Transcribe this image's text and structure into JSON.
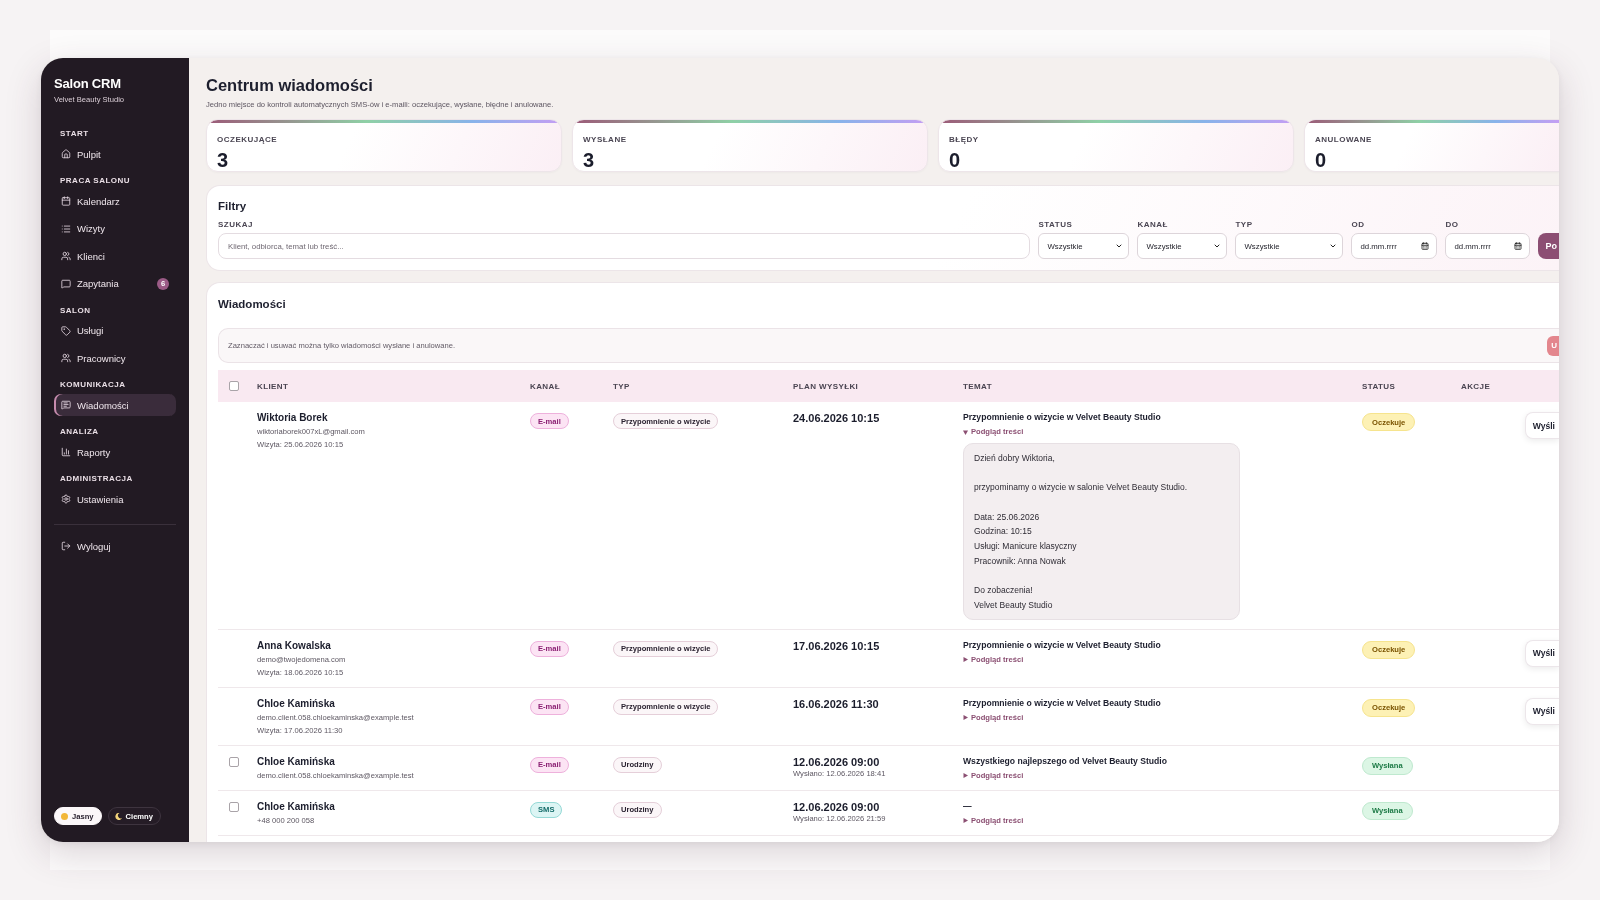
{
  "sidebar": {
    "brand": "Salon CRM",
    "subtitle": "Velvet Beauty Studio",
    "sections": [
      {
        "label": "START",
        "items": [
          {
            "label": "Pulpit",
            "selected": false
          }
        ]
      },
      {
        "label": "PRACA SALONU",
        "items": [
          {
            "label": "Kalendarz",
            "selected": false
          },
          {
            "label": "Wizyty",
            "selected": false
          },
          {
            "label": "Klienci",
            "selected": false
          },
          {
            "label": "Zapytania",
            "selected": false,
            "badge": "6"
          }
        ]
      },
      {
        "label": "SALON",
        "items": [
          {
            "label": "Usługi",
            "selected": false
          },
          {
            "label": "Pracownicy",
            "selected": false
          }
        ]
      },
      {
        "label": "KOMUNIKACJA",
        "items": [
          {
            "label": "Wiadomości",
            "selected": true
          }
        ]
      },
      {
        "label": "ANALIZA",
        "items": [
          {
            "label": "Raporty",
            "selected": false
          }
        ]
      },
      {
        "label": "ADMINISTRACJA",
        "items": [
          {
            "label": "Ustawienia",
            "selected": false
          }
        ]
      }
    ],
    "logout": "Wyloguj",
    "theme": [
      {
        "label": "Jasny",
        "selected": true
      },
      {
        "label": "Ciemny",
        "selected": false
      }
    ]
  },
  "page": {
    "title": "Centrum wiadomości",
    "subtitle": "Jedno miejsce do kontroli automatycznych SMS-ów i e-maili: oczekujące, wysłane, błędne i anulowane."
  },
  "stats": [
    {
      "label": "OCZEKUJĄCE",
      "value": "3"
    },
    {
      "label": "WYSŁANE",
      "value": "3"
    },
    {
      "label": "BŁĘDY",
      "value": "0"
    },
    {
      "label": "ANULOWANE",
      "value": "0"
    }
  ],
  "filters": {
    "title": "Filtry",
    "search": {
      "label": "SZUKAJ",
      "placeholder": "Klient, odbiorca, temat lub treść..."
    },
    "selects": [
      {
        "label": "STATUS",
        "value": "Wszystkie"
      },
      {
        "label": "KANAŁ",
        "value": "Wszystkie"
      },
      {
        "label": "TYP",
        "value": "Wszystkie"
      }
    ],
    "dates": [
      {
        "label": "OD",
        "placeholder": "dd.mm.rrrr"
      },
      {
        "label": "DO",
        "placeholder": "dd.mm.rrrr"
      }
    ],
    "submit": "Po"
  },
  "messages": {
    "title": "Wiadomości",
    "notice": "Zaznaczać i usuwać można tylko wiadomości wysłane i anulowane.",
    "bulk_action": "U",
    "table": {
      "select_all": {
        "checked": false
      },
      "columns": [
        "KLIENT",
        "KANAŁ",
        "TYP",
        "PLAN WYSYŁKI",
        "TEMAT",
        "STATUS",
        "AKCJE"
      ],
      "rows": [
        {
          "selectable": false,
          "client": {
            "name": "Wiktoria Borek",
            "contact": "wiktoriaborek007xL@gmail.com",
            "visit": "Wizyta: 25.06.2026 10:15"
          },
          "channel": {
            "label": "E-mail",
            "kind": "email"
          },
          "type": "Przypomnienie o wizycie",
          "plan": {
            "date": "24.06.2026 10:15"
          },
          "subject": "Przypomnienie o wizycie w Velvet Beauty Studio",
          "preview": {
            "label": "Podgląd treści",
            "expanded": true,
            "paragraphs": [
              "Dzień dobry Wiktoria,",
              "przypominamy o wizycie w salonie Velvet Beauty Studio.",
              "Data: 25.06.2026\nGodzina: 10:15\nUsługi: Manicure klasyczny\nPracownik: Anna Nowak",
              "Do zobaczenia!\nVelvet Beauty Studio"
            ]
          },
          "status": {
            "label": "Oczekuje",
            "kind": "pending"
          },
          "action": "Wyśli"
        },
        {
          "selectable": false,
          "client": {
            "name": "Anna Kowalska",
            "contact": "demo@twojedomena.com",
            "visit": "Wizyta: 18.06.2026 10:15"
          },
          "channel": {
            "label": "E-mail",
            "kind": "email"
          },
          "type": "Przypomnienie o wizycie",
          "plan": {
            "date": "17.06.2026 10:15"
          },
          "subject": "Przypomnienie o wizycie w Velvet Beauty Studio",
          "preview": {
            "label": "Podgląd treści",
            "expanded": false
          },
          "status": {
            "label": "Oczekuje",
            "kind": "pending"
          },
          "action": "Wyśli"
        },
        {
          "selectable": false,
          "client": {
            "name": "Chloe Kamińska",
            "contact": "demo.client.058.chloekaminska@example.test",
            "visit": "Wizyta: 17.06.2026 11:30"
          },
          "channel": {
            "label": "E-mail",
            "kind": "email"
          },
          "type": "Przypomnienie o wizycie",
          "plan": {
            "date": "16.06.2026 11:30"
          },
          "subject": "Przypomnienie o wizycie w Velvet Beauty Studio",
          "preview": {
            "label": "Podgląd treści",
            "expanded": false
          },
          "status": {
            "label": "Oczekuje",
            "kind": "pending"
          },
          "action": "Wyśli"
        },
        {
          "selectable": true,
          "checked": false,
          "client": {
            "name": "Chloe Kamińska",
            "contact": "demo.client.058.chloekaminska@example.test"
          },
          "channel": {
            "label": "E-mail",
            "kind": "email"
          },
          "type": "Urodziny",
          "plan": {
            "date": "12.06.2026 09:00",
            "sent": "Wysłano: 12.06.2026 18:41"
          },
          "subject": "Wszystkiego najlepszego od Velvet Beauty Studio",
          "preview": {
            "label": "Podgląd treści",
            "expanded": false
          },
          "status": {
            "label": "Wysłana",
            "kind": "sent"
          }
        },
        {
          "selectable": true,
          "checked": false,
          "client": {
            "name": "Chloe Kamińska",
            "contact": "+48 000 200 058"
          },
          "channel": {
            "label": "SMS",
            "kind": "sms"
          },
          "type": "Urodziny",
          "plan": {
            "date": "12.06.2026 09:00",
            "sent": "Wysłano: 12.06.2026 21:59"
          },
          "subject": "—",
          "preview": {
            "label": "Podgląd treści",
            "expanded": false
          },
          "status": {
            "label": "Wysłana",
            "kind": "sent"
          }
        }
      ]
    }
  }
}
